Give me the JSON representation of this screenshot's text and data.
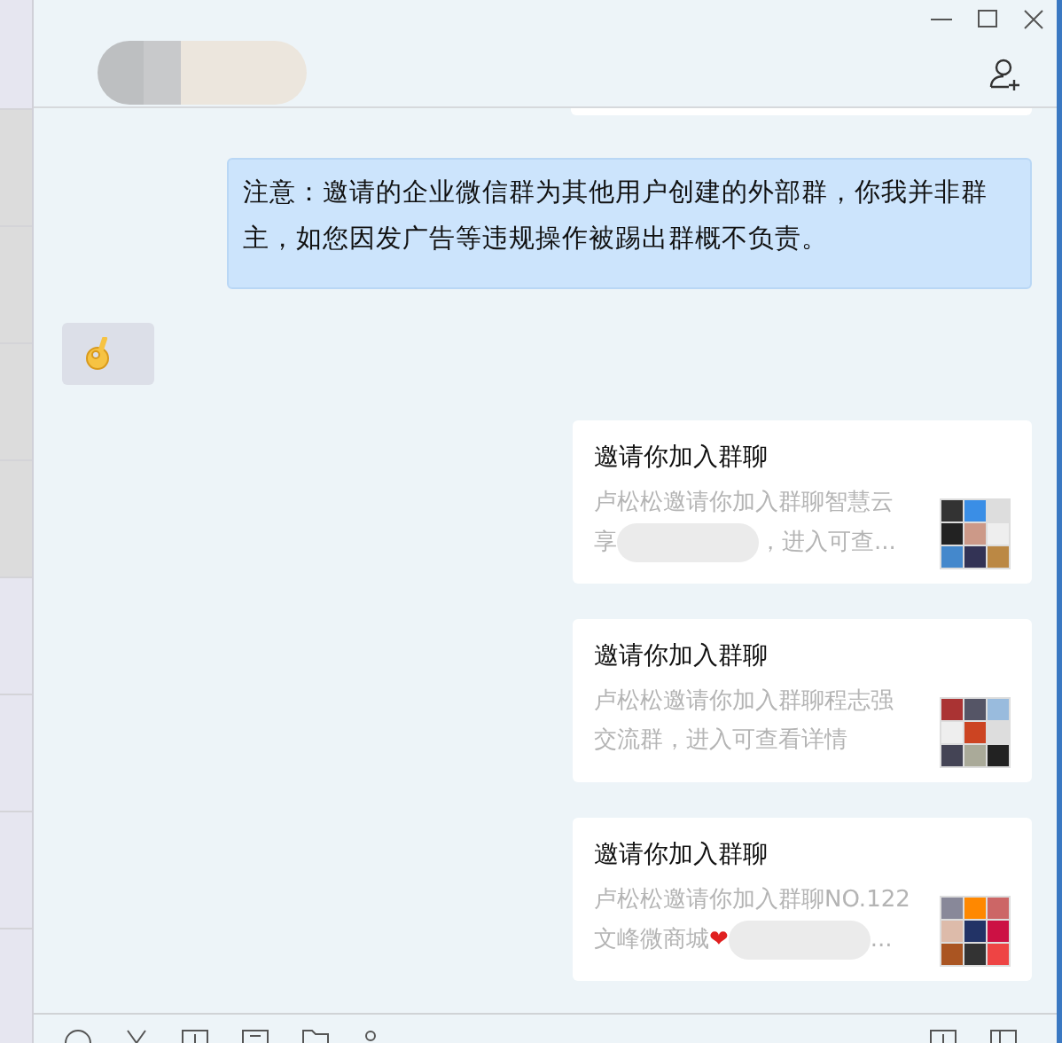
{
  "header": {
    "title_redacted": true
  },
  "messages": [
    {
      "kind": "text",
      "outgoing": true,
      "text": "注意：邀请的企业微信群为其他用户创建的外部群，你我并非群主，如您因发广告等违规操作被踢出群概不负责。"
    },
    {
      "kind": "sticker",
      "outgoing": false
    },
    {
      "kind": "invite",
      "outgoing": true,
      "title": "邀请你加入群聊",
      "desc": "卢松松邀请你加入群聊智慧云享",
      "redacted": true,
      "desc_after": "，进入可查..."
    },
    {
      "kind": "invite",
      "outgoing": true,
      "title": "邀请你加入群聊",
      "desc": "卢松松邀请你加入群聊程志强交流群，进入可查看详情",
      "redacted": false
    },
    {
      "kind": "invite",
      "outgoing": true,
      "title": "邀请你加入群聊",
      "desc": "卢松松邀请你加入群聊NO.122 文峰微商城",
      "emoji": "❤",
      "redacted": true,
      "desc_after": "..."
    }
  ]
}
